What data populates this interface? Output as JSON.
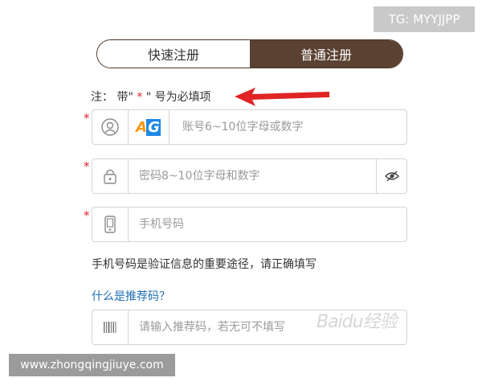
{
  "badge": {
    "tg_label": "TG: MYYJJPP"
  },
  "tabs": [
    {
      "label": "快速注册",
      "active": false
    },
    {
      "label": "普通注册",
      "active": true
    }
  ],
  "note": {
    "prefix": "注： 带\"",
    "stars": " * ",
    "suffix": "\" 号为必填项"
  },
  "required_mark": "*",
  "fields": {
    "account": {
      "placeholder": "账号6~10位字母或数字",
      "logo_a": "A",
      "logo_g": "G",
      "icon": "user-icon"
    },
    "password": {
      "placeholder": "密码8~10位字母和数字",
      "icon": "lock-icon",
      "toggle_icon": "eye-off-icon"
    },
    "phone": {
      "placeholder": "手机号码",
      "icon": "phone-icon"
    },
    "referral": {
      "placeholder": "请输入推荐码，若无可不填写",
      "icon": "barcode-icon"
    }
  },
  "phone_note": "手机号码是验证信息的重要途径，请正确填写",
  "referral_link": "什么是推荐码？",
  "watermark": {
    "site": "www.zhongqingjiuye.com",
    "baidu": "Baidu经验"
  },
  "colors": {
    "brand_brown": "#5a4131",
    "required_red": "#e02424",
    "link_blue": "#1f6fb4"
  }
}
